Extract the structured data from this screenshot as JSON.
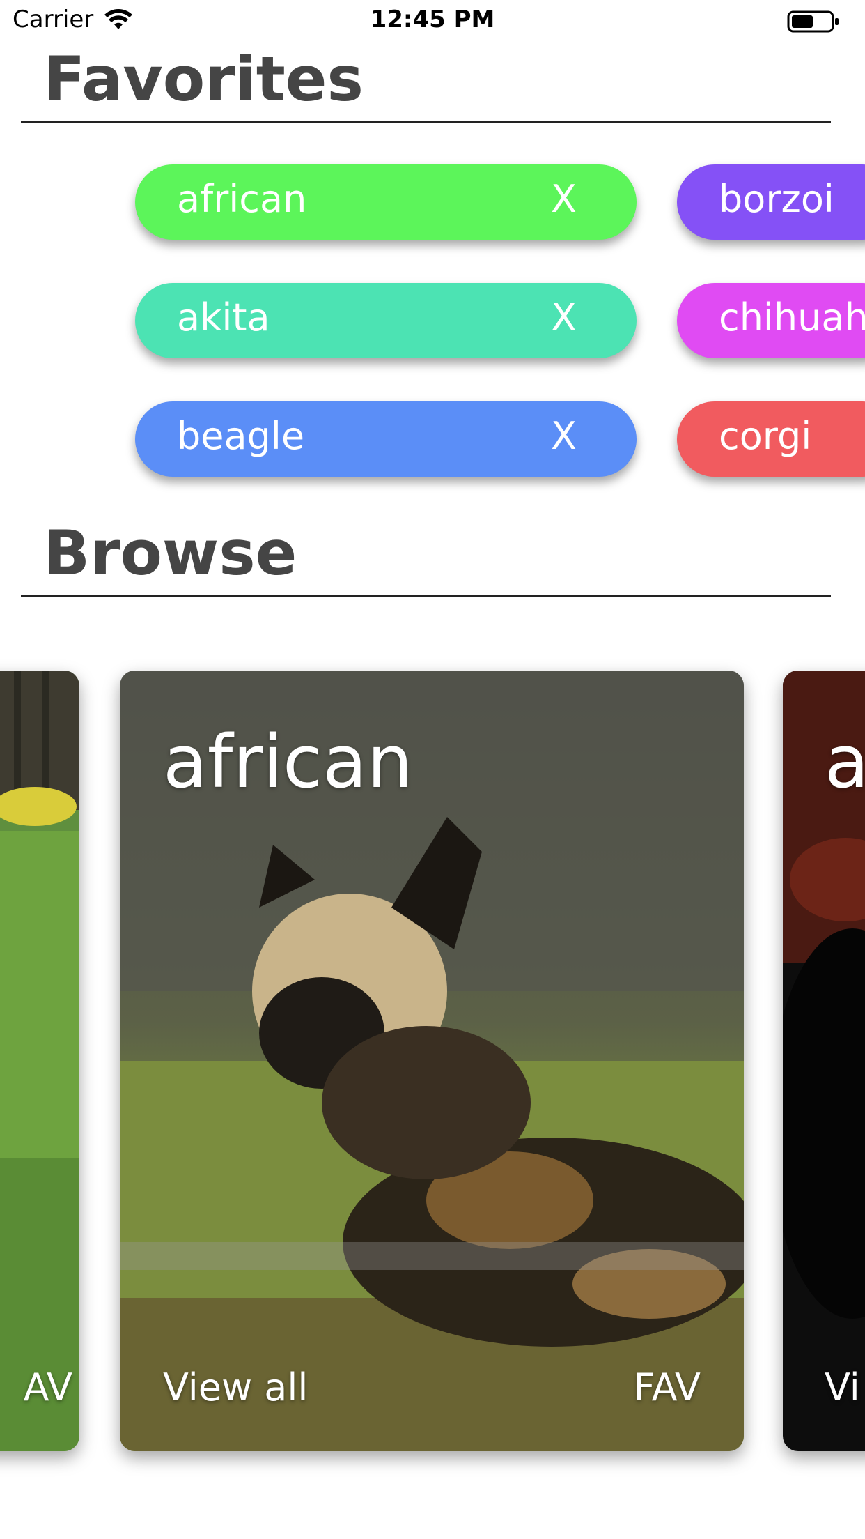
{
  "status_bar": {
    "carrier": "Carrier",
    "time": "12:45 PM"
  },
  "favorites": {
    "title": "Favorites",
    "items": [
      {
        "label": "african",
        "remove": "X",
        "color": "#5CF55A"
      },
      {
        "label": "akita",
        "remove": "X",
        "color": "#4CE3B3"
      },
      {
        "label": "beagle",
        "remove": "X",
        "color": "#5B8EF7"
      },
      {
        "label": "borzoi",
        "color": "#8551F6"
      },
      {
        "label": "chihuah",
        "color": "#E04BF3"
      },
      {
        "label": "corgi",
        "color": "#F15B5F"
      }
    ]
  },
  "browse": {
    "title": "Browse",
    "cards": [
      {
        "view": "AV"
      },
      {
        "title": "african",
        "view": "View all",
        "fav": "FAV"
      },
      {
        "title": "a",
        "view": "Vi"
      }
    ]
  }
}
